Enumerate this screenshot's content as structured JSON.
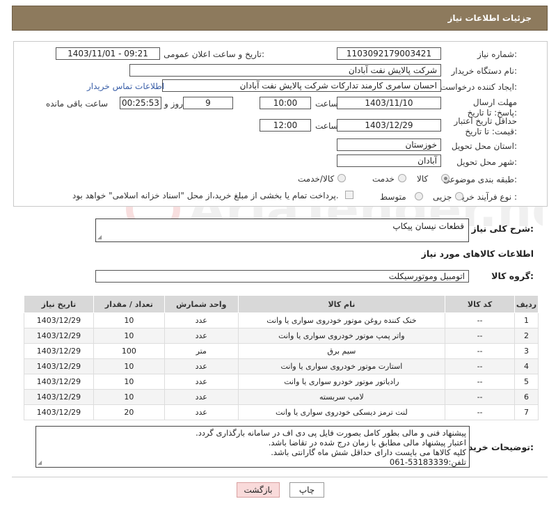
{
  "header": {
    "title": "جزئیات اطلاعات نیاز"
  },
  "fields": {
    "need_number_label": "شماره نیاز:",
    "need_number": "1103092179003421",
    "announce_label": "تاریخ و ساعت اعلان عمومی:",
    "announce_value": "1403/11/01 - 09:21",
    "buyer_org_label": "نام دستگاه خریدار:",
    "buyer_org": "شرکت پالایش نفت آبادان",
    "creator_label": "ایجاد کننده درخواست:",
    "creator": "احسان سامری کارمند تدارکات شرکت پالایش نفت آبادان",
    "contact_link": "اطلاعات تماس خریدار",
    "deadline_label": "مهلت ارسال پاسخ: تا تاریخ:",
    "deadline_date": "1403/11/10",
    "time_label": "ساعت",
    "deadline_time": "10:00",
    "days": "9",
    "days_label": "روز و",
    "remaining": "00:25:53",
    "remaining_label": "ساعت باقی مانده",
    "validity_label": "حداقل تاریخ اعتبار قیمت: تا تاریخ:",
    "validity_date": "1403/12/29",
    "validity_time": "12:00",
    "province_label": "استان محل تحویل:",
    "province": "خوزستان",
    "city_label": "شهر محل تحویل:",
    "city": "آبادان",
    "category_label": "طبقه بندی موضوعی:",
    "category_options": [
      "کالا",
      "خدمت",
      "کالا/خدمت"
    ],
    "process_label": "نوع فرآیند خرید :",
    "process_options": [
      "جزیی",
      "متوسط"
    ],
    "payment_note": "پرداخت تمام یا بخشی از مبلغ خرید،از محل \"اسناد خزانه اسلامی\" خواهد بود."
  },
  "description": {
    "label": "شرح کلی نیاز:",
    "value": "قطعات نیسان پیکاپ"
  },
  "goods": {
    "section_title": "اطلاعات کالاهای مورد نیاز",
    "group_label": "گروه کالا:",
    "group_value": "اتومبیل وموتورسیکلت",
    "columns": [
      "ردیف",
      "کد کالا",
      "نام کالا",
      "واحد شمارش",
      "تعداد / مقدار",
      "تاریخ نیاز"
    ],
    "rows": [
      [
        "1",
        "--",
        "خنک کننده روغن موتور خودروی سواری یا وانت",
        "عدد",
        "10",
        "1403/12/29"
      ],
      [
        "2",
        "--",
        "واتر پمپ موتور خودروی سواری یا وانت",
        "عدد",
        "10",
        "1403/12/29"
      ],
      [
        "3",
        "--",
        "سیم برق",
        "متر",
        "100",
        "1403/12/29"
      ],
      [
        "4",
        "--",
        "استارت موتور خودروی سواری یا وانت",
        "عدد",
        "10",
        "1403/12/29"
      ],
      [
        "5",
        "--",
        "رادیاتور موتور خودرو سواری یا وانت",
        "عدد",
        "10",
        "1403/12/29"
      ],
      [
        "6",
        "--",
        "لامپ سربسته",
        "عدد",
        "10",
        "1403/12/29"
      ],
      [
        "7",
        "--",
        "لنت ترمز دیسکی خودروی سواری یا وانت",
        "عدد",
        "20",
        "1403/12/29"
      ]
    ]
  },
  "buyer_notes": {
    "label": "توضیحات خریدار:",
    "lines": [
      "پیشنهاد فنی و مالی بطور کامل بصورت فایل پی دی اف در سامانه بارگذاری گردد.",
      "اعتبار پیشنهاد مالی مطابق با زمان درج شده در تقاضا باشد.",
      "کلیه کالاها می بایست دارای حداقل شش ماه گارانتی باشد.",
      "تلفن:53183339-061"
    ]
  },
  "buttons": {
    "print": "چاپ",
    "back": "بازگشت"
  },
  "watermark": "AriaTender.neT"
}
